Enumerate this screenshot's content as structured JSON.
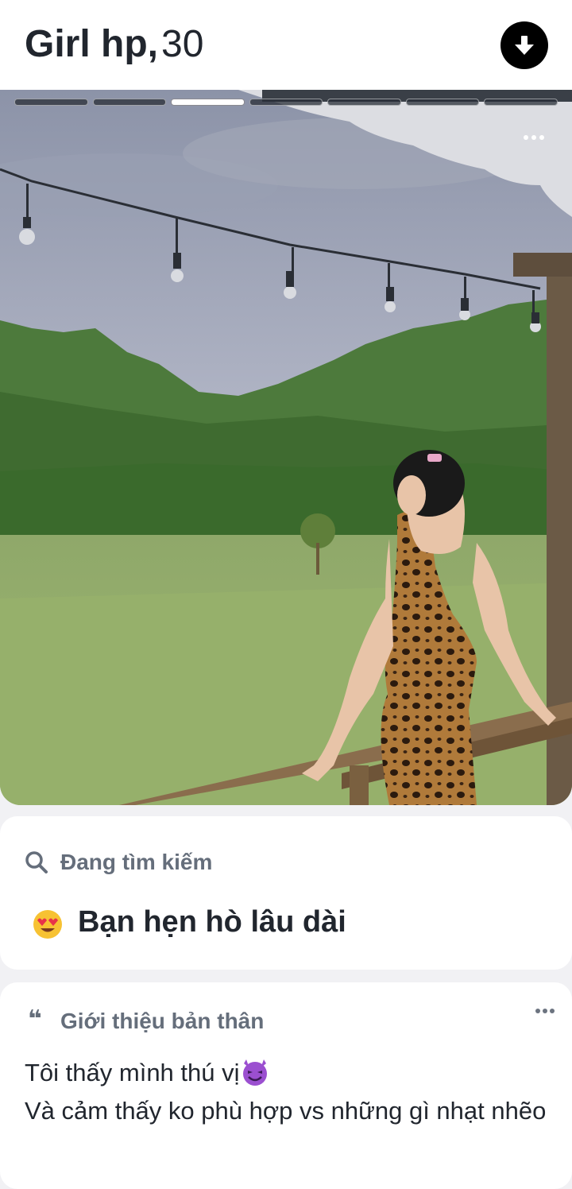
{
  "profile": {
    "name": "Girl hp,",
    "age": "30"
  },
  "photo": {
    "total_photos": 7,
    "active_index": 2
  },
  "looking_for": {
    "title": "Đang tìm kiếm",
    "value": "Bạn hẹn hò lâu dài",
    "emoji": "heart-eyes-emoji"
  },
  "bio": {
    "title": "Giới thiệu bản thân",
    "quote_mark": "❝",
    "line1": "Tôi thấy mình thú vị",
    "line2": "Và cảm thấy ko phù hợp vs những gì nhạt nhẽo"
  },
  "colors": {
    "text_primary": "#21262e",
    "text_secondary": "#656e7b",
    "background": "#f1f1f4"
  }
}
